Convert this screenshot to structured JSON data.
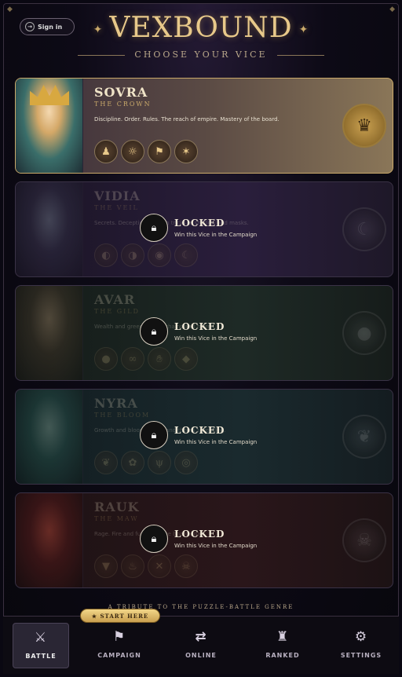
{
  "header": {
    "signin_label": "Sign in",
    "title": "VEXBOUND",
    "subtitle": "CHOOSE YOUR VICE"
  },
  "cards": [
    {
      "name": "SOVRA",
      "role": "THE CROWN",
      "desc": "Discipline. Order. Rules. The reach of empire. Mastery of the board.",
      "icons": [
        "pawn-icon",
        "sun-icon",
        "banner-icon",
        "eagle-icon"
      ],
      "emblem": "crown-emblem-icon",
      "locked": false,
      "theme": "#8a7658"
    },
    {
      "name": "VIDIA",
      "role": "THE VEIL",
      "desc": "Secrets. Deception. Hidden tricks in shadow and masks.",
      "locked": true,
      "lock_title": "LOCKED",
      "lock_sub": "Win this Vice in the Campaign",
      "theme": "#2a1e3c"
    },
    {
      "name": "AVAR",
      "role": "THE GILD",
      "desc": "Wealth and greed. Coins, chains and more.",
      "locked": true,
      "lock_title": "LOCKED",
      "lock_sub": "Win this Vice in the Campaign",
      "theme": "#1e2a26"
    },
    {
      "name": "NYRA",
      "role": "THE BLOOM",
      "desc": "Growth and bloom. Roots and thorns spreading.",
      "locked": true,
      "lock_title": "LOCKED",
      "lock_sub": "Win this Vice in the Campaign",
      "theme": "#1a2a2e"
    },
    {
      "name": "RAUK",
      "role": "THE MAW",
      "desc": "Rage. Fire and fury. Tear the board apart.",
      "locked": true,
      "lock_title": "LOCKED",
      "lock_sub": "Win this Vice in the Campaign",
      "theme": "#2a161a"
    }
  ],
  "tribute": "A TRIBUTE TO THE PUZZLE-BATTLE GENRE",
  "nav": {
    "start_badge": "★ START HERE",
    "items": [
      {
        "label": "BATTLE",
        "icon": "sword-icon",
        "active": true
      },
      {
        "label": "CAMPAIGN",
        "icon": "flag-icon",
        "active": false
      },
      {
        "label": "ONLINE",
        "icon": "swap-icon",
        "active": false
      },
      {
        "label": "RANKED",
        "icon": "trophy-icon",
        "active": false
      },
      {
        "label": "SETTINGS",
        "icon": "gear-icon",
        "active": false
      }
    ]
  }
}
